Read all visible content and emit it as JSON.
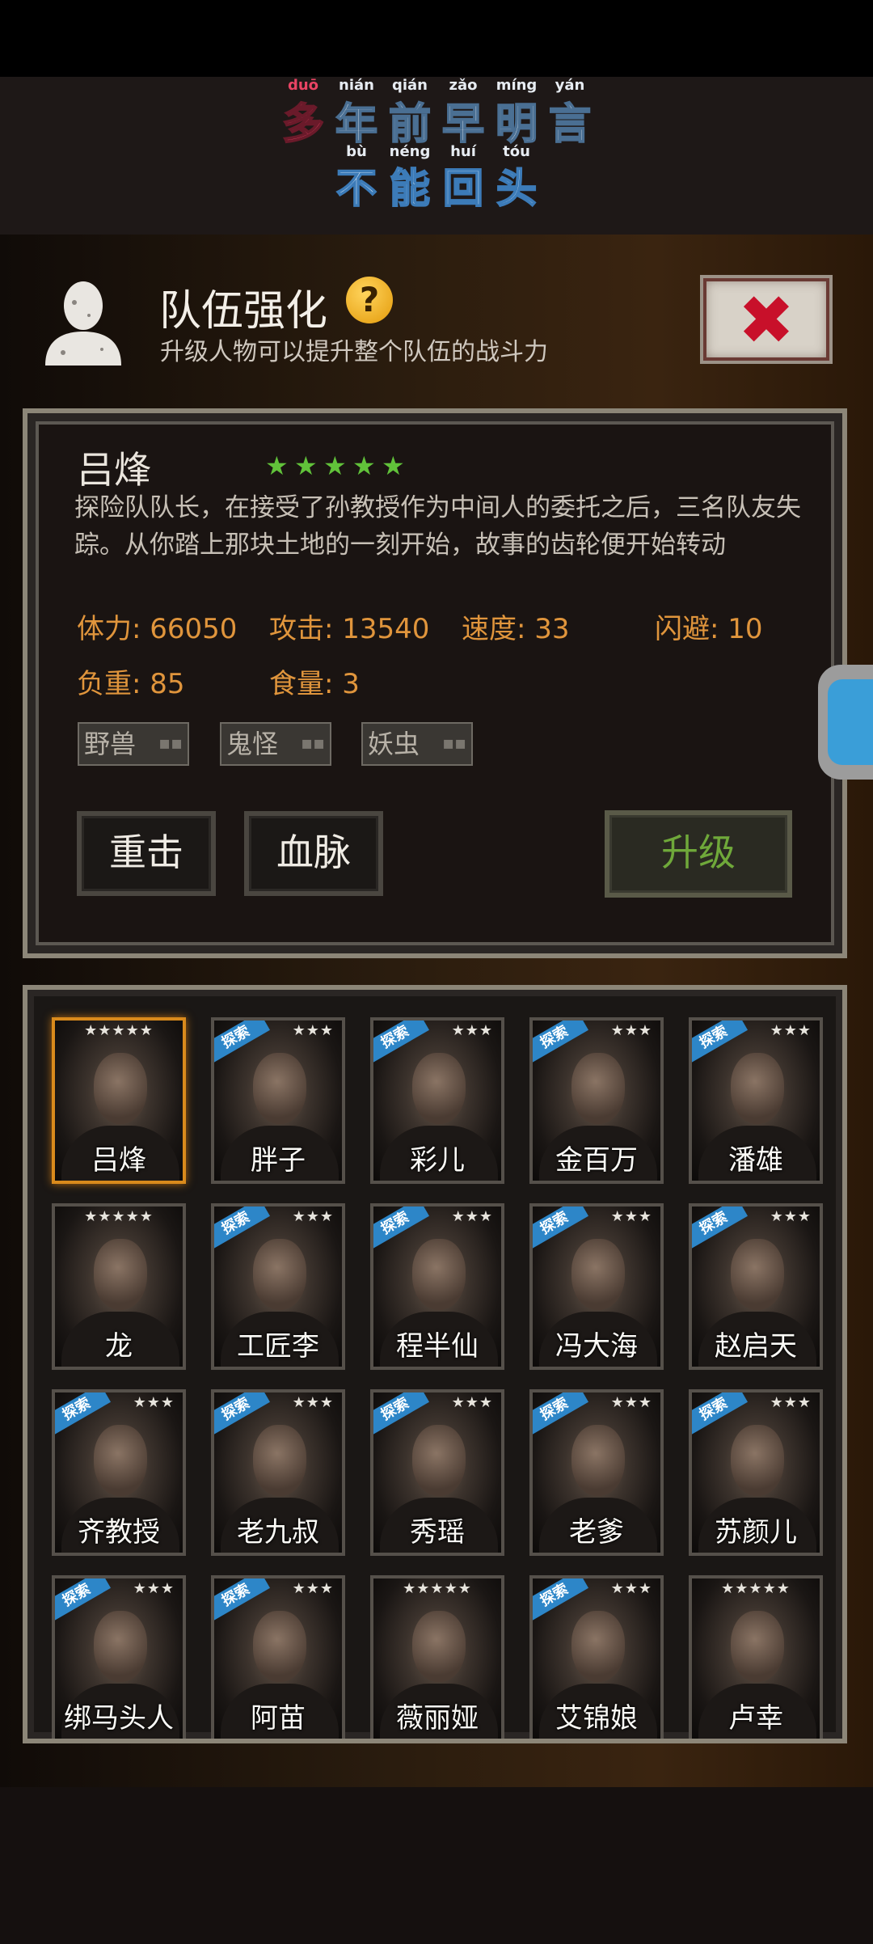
{
  "banner": {
    "line1": [
      {
        "pinyin": "duō",
        "hanzi": "多"
      },
      {
        "pinyin": "nián",
        "hanzi": "年"
      },
      {
        "pinyin": "qián",
        "hanzi": "前"
      },
      {
        "pinyin": "zǎo",
        "hanzi": "早"
      },
      {
        "pinyin": "míng",
        "hanzi": "明"
      },
      {
        "pinyin": "yán",
        "hanzi": "言"
      }
    ],
    "line2": [
      {
        "pinyin": "bù",
        "hanzi": "不"
      },
      {
        "pinyin": "néng",
        "hanzi": "能"
      },
      {
        "pinyin": "huí",
        "hanzi": "回"
      },
      {
        "pinyin": "tóu",
        "hanzi": "头"
      }
    ]
  },
  "header": {
    "title": "队伍强化",
    "help": "?",
    "subtitle": "升级人物可以提升整个队伍的战斗力",
    "close": "✖"
  },
  "character": {
    "name": "吕烽",
    "stars": 5,
    "description": "探险队队长，在接受了孙教授作为中间人的委托之后，三名队友失踪。从你踏上那块土地的一刻开始，故事的齿轮便开始转动",
    "stats": {
      "hp": "体力: 66050",
      "attack": "攻击: 13540",
      "speed": "速度: 33",
      "dodge": "闪避: 10",
      "load": "负重: 85",
      "food": "食量: 3"
    },
    "tags": [
      "野兽",
      "鬼怪",
      "妖虫"
    ],
    "buttons": {
      "heavy_strike": "重击",
      "bloodline": "血脉",
      "upgrade": "升级"
    }
  },
  "roster": {
    "explore_label": "探索",
    "members": [
      {
        "name": "吕烽",
        "stars": "★★★★★",
        "explore": false,
        "selected": true
      },
      {
        "name": "胖子",
        "stars": "★★★",
        "explore": true
      },
      {
        "name": "彩儿",
        "stars": "★★★",
        "explore": true
      },
      {
        "name": "金百万",
        "stars": "★★★",
        "explore": true
      },
      {
        "name": "潘雄",
        "stars": "★★★",
        "explore": true
      },
      {
        "name": "龙",
        "stars": "★★★★★",
        "explore": false
      },
      {
        "name": "工匠李",
        "stars": "★★★",
        "explore": true
      },
      {
        "name": "程半仙",
        "stars": "★★★",
        "explore": true
      },
      {
        "name": "冯大海",
        "stars": "★★★",
        "explore": true
      },
      {
        "name": "赵启天",
        "stars": "★★★",
        "explore": true
      },
      {
        "name": "齐教授",
        "stars": "★★★",
        "explore": true
      },
      {
        "name": "老九叔",
        "stars": "★★★",
        "explore": true
      },
      {
        "name": "秀瑶",
        "stars": "★★★",
        "explore": true
      },
      {
        "name": "老爹",
        "stars": "★★★",
        "explore": true
      },
      {
        "name": "苏颜儿",
        "stars": "★★★",
        "explore": true
      },
      {
        "name": "绑马头人",
        "stars": "★★★",
        "explore": true
      },
      {
        "name": "阿苗",
        "stars": "★★★",
        "explore": true
      },
      {
        "name": "薇丽娅",
        "stars": "★★★★★",
        "explore": false
      },
      {
        "name": "艾锦娘",
        "stars": "★★★",
        "explore": true
      },
      {
        "name": "卢幸",
        "stars": "★★★★★",
        "explore": false
      }
    ]
  }
}
